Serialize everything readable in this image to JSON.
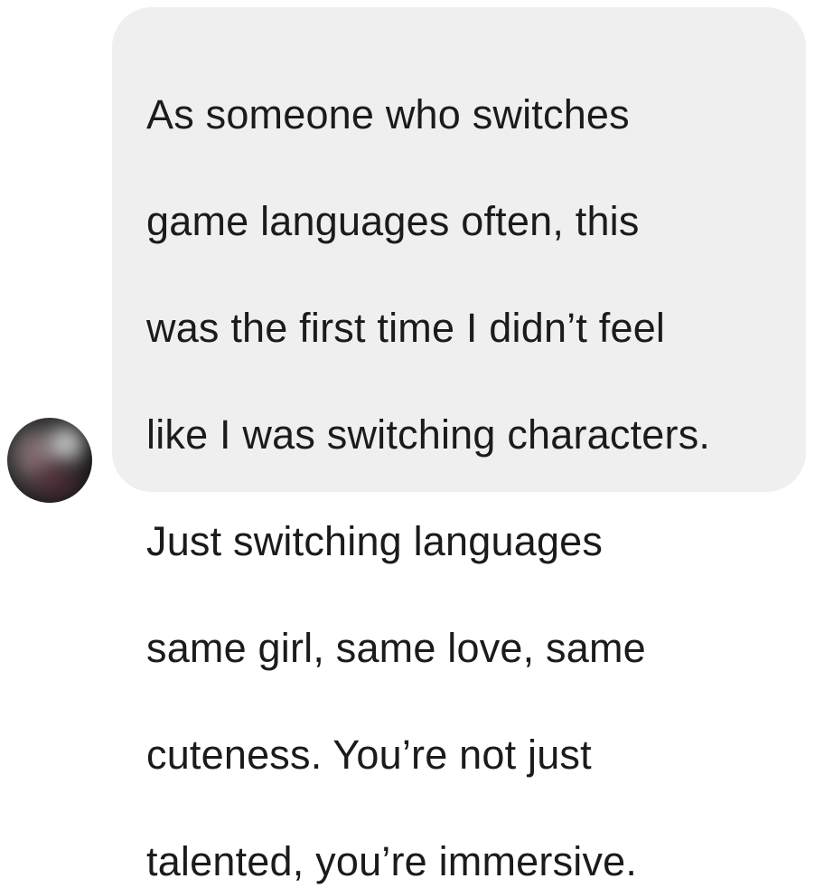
{
  "message": {
    "lines": [
      "As someone who switches",
      "game languages often, this",
      "was the first time I didn’t feel",
      "like I was switching characters.",
      "Just switching languages",
      "same girl, same love, same",
      "cuteness. You’re not just",
      "talented, you’re immersive."
    ]
  },
  "colors": {
    "bubble_background": "#efefef",
    "text": "#1b1b1b",
    "page_background": "#ffffff"
  },
  "icons": {
    "avatar": "blurred-profile-avatar"
  }
}
